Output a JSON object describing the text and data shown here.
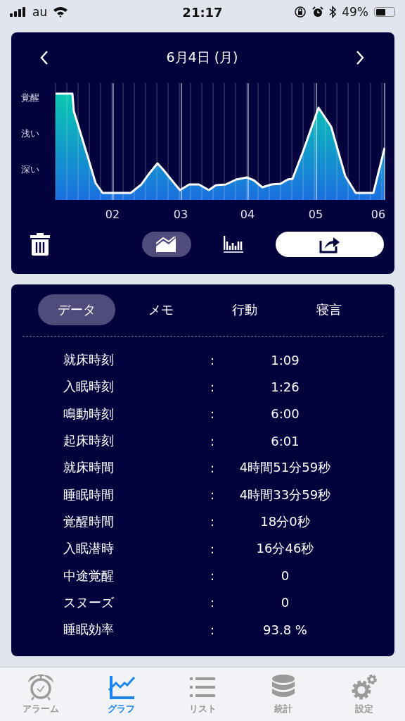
{
  "status_bar": {
    "carrier": "au",
    "time": "21:17",
    "battery": "49%"
  },
  "chart_card": {
    "title": "6月4日 (月)",
    "y_labels": [
      "覚醒",
      "浅い",
      "深い"
    ],
    "x_labels": [
      "02",
      "03",
      "04",
      "05",
      "06"
    ],
    "views": [
      {
        "kind": "line",
        "selected": true
      },
      {
        "kind": "bar",
        "selected": false
      }
    ]
  },
  "data_card": {
    "tabs": [
      {
        "label": "データ",
        "selected": true
      },
      {
        "label": "メモ",
        "selected": false
      },
      {
        "label": "行動",
        "selected": false
      },
      {
        "label": "寝言",
        "selected": false
      }
    ],
    "rows": [
      {
        "label": "就床時刻",
        "sep": ":",
        "value": "1:09"
      },
      {
        "label": "入眠時刻",
        "sep": ":",
        "value": "1:26"
      },
      {
        "label": "鳴動時刻",
        "sep": ":",
        "value": "6:00"
      },
      {
        "label": "起床時刻",
        "sep": ":",
        "value": "6:01"
      },
      {
        "label": "就床時間",
        "sep": ":",
        "value": "4時間51分59秒"
      },
      {
        "label": "睡眠時間",
        "sep": ":",
        "value": "4時間33分59秒"
      },
      {
        "label": "覚醒時間",
        "sep": ":",
        "value": "18分0秒"
      },
      {
        "label": "入眠潜時",
        "sep": ":",
        "value": "16分46秒"
      },
      {
        "label": "中途覚醒",
        "sep": ":",
        "value": "0"
      },
      {
        "label": "スヌーズ",
        "sep": ":",
        "value": "0"
      },
      {
        "label": "睡眠効率",
        "sep": ":",
        "value": "93.8 %"
      }
    ]
  },
  "tab_bar": [
    {
      "kind": "alarm",
      "label": "アラーム",
      "selected": false
    },
    {
      "kind": "graph",
      "label": "グラフ",
      "selected": true
    },
    {
      "kind": "list",
      "label": "リスト",
      "selected": false
    },
    {
      "kind": "stats",
      "label": "統計",
      "selected": false
    },
    {
      "kind": "settings",
      "label": "設定",
      "selected": false
    }
  ]
}
